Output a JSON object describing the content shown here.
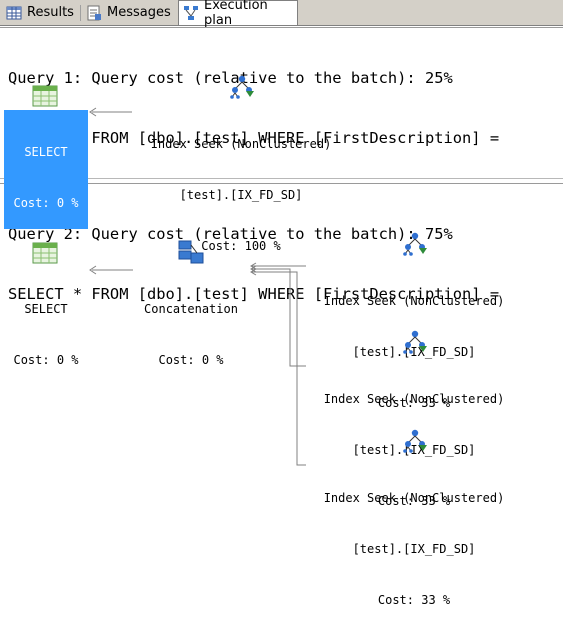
{
  "tabs": [
    {
      "label": "Results",
      "icon": "grid-icon"
    },
    {
      "label": "Messages",
      "icon": "messages-icon"
    },
    {
      "label": "Execution plan",
      "icon": "plan-icon",
      "active": true
    }
  ],
  "queries": [
    {
      "header": "Query 1: Query cost (relative to the batch): 25%",
      "sql": "SELECT * FROM [dbo].[test] WHERE [FirstDescription] = ",
      "nodes": {
        "select": {
          "name": "SELECT",
          "cost": "Cost: 0 %",
          "selected": true
        },
        "seek": {
          "name": "Index Seek (NonClustered)",
          "object": "[test].[IX_FD_SD]",
          "cost": "Cost: 100 %"
        }
      }
    },
    {
      "header": "Query 2: Query cost (relative to the batch): 75%",
      "sql": "SELECT * FROM [dbo].[test] WHERE [FirstDescription] = ",
      "nodes": {
        "select": {
          "name": "SELECT",
          "cost": "Cost: 0 %"
        },
        "concat": {
          "name": "Concatenation",
          "cost": "Cost: 0 %"
        },
        "seeks": [
          {
            "name": "Index Seek (NonClustered)",
            "object": "[test].[IX_FD_SD]",
            "cost": "Cost: 33 %"
          },
          {
            "name": "Index Seek (NonClustered)",
            "object": "[test].[IX_FD_SD]",
            "cost": "Cost: 33 %"
          },
          {
            "name": "Index Seek (NonClustered)",
            "object": "[test].[IX_FD_SD]",
            "cost": "Cost: 33 %"
          }
        ]
      }
    }
  ],
  "colors": {
    "selection": "#3399ff",
    "connector": "#808080",
    "tab_bg": "#d4d0c8"
  }
}
